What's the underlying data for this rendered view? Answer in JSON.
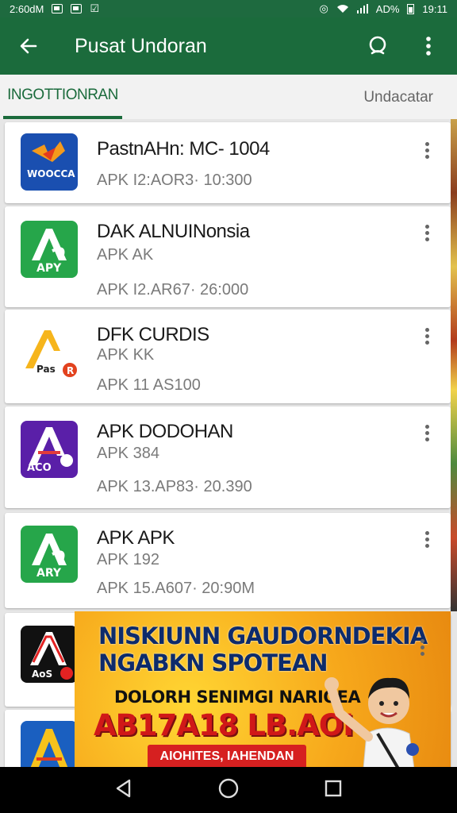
{
  "status_bar": {
    "time": "2:60dM",
    "battery_text": "AD%",
    "clock_right": "19:11"
  },
  "app_bar": {
    "title": "Pusat Undoran"
  },
  "tabs": {
    "active": "INGOTTIONRAN",
    "other": "Undacatar"
  },
  "apps": [
    {
      "name": "PastnAHn: MC- 1004",
      "sub": "",
      "meta": "APK I2:AOR3· 10:300",
      "icon_label": "WOOCCA",
      "icon_color": "#1a4fb0"
    },
    {
      "name": "DAK ALNUINonsia",
      "sub": "APK AK",
      "meta": "APK I2.AR67· 26:000",
      "icon_label": "APY",
      "icon_color": "#26a64a"
    },
    {
      "name": "DFK CURDIS",
      "sub": "APK KK",
      "meta": "APK 11 AS100",
      "icon_label": "Pas",
      "icon_color": "#ffffff"
    },
    {
      "name": "APK DODOHAN",
      "sub": "APK 384",
      "meta": "APK 13.AP83· 20.390",
      "icon_label": "ACO",
      "icon_color": "#5a1fa8"
    },
    {
      "name": "APK APK",
      "sub": "APK 192",
      "meta": "APK 15.A607· 20:90M",
      "icon_label": "ARY",
      "icon_color": "#26a64a"
    }
  ],
  "partial_apps": [
    {
      "icon_label": "AoS",
      "icon_color": "#111111"
    },
    {
      "icon_label": "",
      "icon_color": "#1a5fc0"
    }
  ],
  "banner": {
    "line1": "NISKIUNN GAUDORNDEKIA",
    "line2": "NGABKN SPOTEAN",
    "line3": "DOLORH SENIMGI NARIOEA",
    "line4": "AB17A18 LB.AOI",
    "ribbon": "AIOHITES, IAHENDAN"
  }
}
